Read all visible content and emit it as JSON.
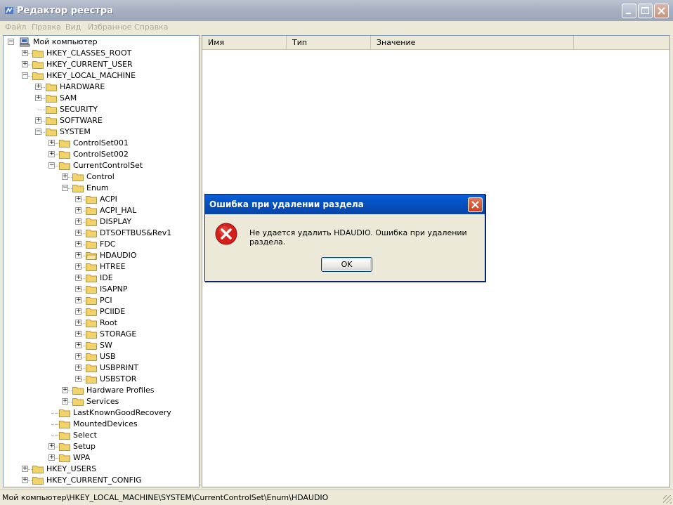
{
  "window": {
    "title": "Редактор реестра"
  },
  "menu": [
    "Файл",
    "Правка",
    "Вид",
    "Избранное",
    "Справка"
  ],
  "tree": {
    "root_label": "Мой компьютер",
    "nodes": [
      {
        "label": "HKEY_CLASSES_ROOT",
        "level": 1,
        "expander": "+"
      },
      {
        "label": "HKEY_CURRENT_USER",
        "level": 1,
        "expander": "+"
      },
      {
        "label": "HKEY_LOCAL_MACHINE",
        "level": 1,
        "expander": "-"
      },
      {
        "label": "HARDWARE",
        "level": 2,
        "expander": "+"
      },
      {
        "label": "SAM",
        "level": 2,
        "expander": "+"
      },
      {
        "label": "SECURITY",
        "level": 2,
        "expander": ""
      },
      {
        "label": "SOFTWARE",
        "level": 2,
        "expander": "+"
      },
      {
        "label": "SYSTEM",
        "level": 2,
        "expander": "-"
      },
      {
        "label": "ControlSet001",
        "level": 3,
        "expander": "+"
      },
      {
        "label": "ControlSet002",
        "level": 3,
        "expander": "+"
      },
      {
        "label": "CurrentControlSet",
        "level": 3,
        "expander": "-"
      },
      {
        "label": "Control",
        "level": 4,
        "expander": "+"
      },
      {
        "label": "Enum",
        "level": 4,
        "expander": "-"
      },
      {
        "label": "ACPI",
        "level": 5,
        "expander": "+"
      },
      {
        "label": "ACPI_HAL",
        "level": 5,
        "expander": "+"
      },
      {
        "label": "DISPLAY",
        "level": 5,
        "expander": "+"
      },
      {
        "label": "DTSOFTBUS&Rev1",
        "level": 5,
        "expander": "+"
      },
      {
        "label": "FDC",
        "level": 5,
        "expander": "+"
      },
      {
        "label": "HDAUDIO",
        "level": 5,
        "expander": "+",
        "open": true
      },
      {
        "label": "HTREE",
        "level": 5,
        "expander": "+"
      },
      {
        "label": "IDE",
        "level": 5,
        "expander": "+"
      },
      {
        "label": "ISAPNP",
        "level": 5,
        "expander": "+"
      },
      {
        "label": "PCI",
        "level": 5,
        "expander": "+"
      },
      {
        "label": "PCIIDE",
        "level": 5,
        "expander": "+"
      },
      {
        "label": "Root",
        "level": 5,
        "expander": "+"
      },
      {
        "label": "STORAGE",
        "level": 5,
        "expander": "+"
      },
      {
        "label": "SW",
        "level": 5,
        "expander": "+"
      },
      {
        "label": "USB",
        "level": 5,
        "expander": "+"
      },
      {
        "label": "USBPRINT",
        "level": 5,
        "expander": "+"
      },
      {
        "label": "USBSTOR",
        "level": 5,
        "expander": "+"
      },
      {
        "label": "Hardware Profiles",
        "level": 4,
        "expander": "+"
      },
      {
        "label": "Services",
        "level": 4,
        "expander": "+"
      },
      {
        "label": "LastKnownGoodRecovery",
        "level": 3,
        "expander": ""
      },
      {
        "label": "MountedDevices",
        "level": 3,
        "expander": ""
      },
      {
        "label": "Select",
        "level": 3,
        "expander": ""
      },
      {
        "label": "Setup",
        "level": 3,
        "expander": "+"
      },
      {
        "label": "WPA",
        "level": 3,
        "expander": "+"
      },
      {
        "label": "HKEY_USERS",
        "level": 1,
        "expander": "+"
      },
      {
        "label": "HKEY_CURRENT_CONFIG",
        "level": 1,
        "expander": "+"
      }
    ]
  },
  "list": {
    "columns": [
      "Имя",
      "Тип",
      "Значение"
    ]
  },
  "status": {
    "path": "Мой компьютер\\HKEY_LOCAL_MACHINE\\SYSTEM\\CurrentControlSet\\Enum\\HDAUDIO"
  },
  "dialog": {
    "title": "Ошибка при удалении раздела",
    "message": "Не удается удалить HDAUDIO.  Ошибка при удалении раздела.",
    "ok_label": "OK"
  },
  "colors": {
    "folder": "#f2d36b",
    "error_red": "#d4221a",
    "dialog_title": "#0553c4"
  },
  "icons": {
    "app": "regedit-icon",
    "computer": "computer-icon",
    "folder": "folder-icon",
    "error": "error-icon"
  }
}
